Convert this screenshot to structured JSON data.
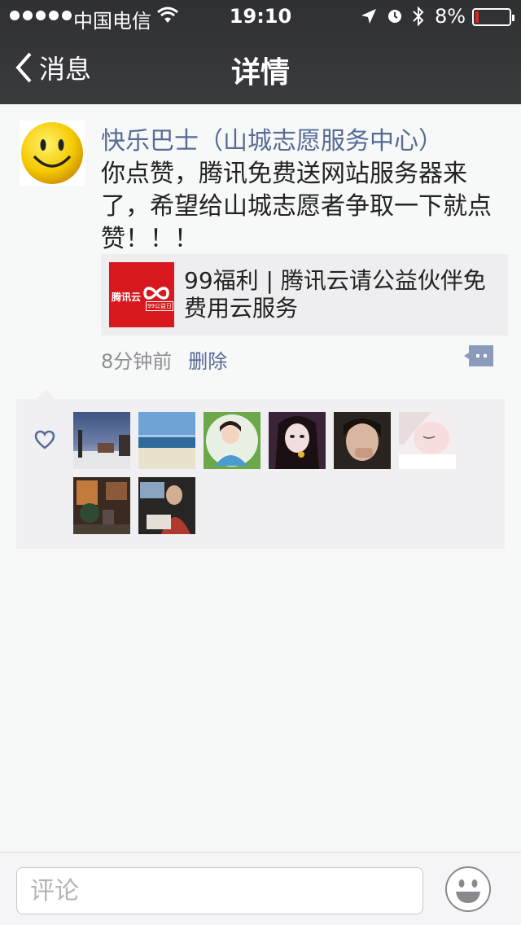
{
  "status": {
    "carrier": "中国电信",
    "time": "19:10",
    "battery_text": "8%"
  },
  "nav": {
    "back_label": "消息",
    "title": "详情"
  },
  "post": {
    "author": "快乐巴士（山城志愿服务中心）",
    "content": "你点赞，腾讯免费送网站服务器来了，希望给山城志愿者争取一下就点赞！！！",
    "link": {
      "thumb_text": "腾讯云",
      "thumb_tag": "99公益日",
      "title": "99福利 | 腾讯云请公益伙伴免费用云服务"
    },
    "time_ago": "8分钟前",
    "delete_label": "删除"
  },
  "likes": {
    "count": 8,
    "icons": [
      "heart-icon"
    ]
  },
  "comment": {
    "placeholder": "评论"
  },
  "colors": {
    "nav_bg": "#333438",
    "link_blue": "#576b95",
    "page_bg": "#f7f8f8"
  }
}
